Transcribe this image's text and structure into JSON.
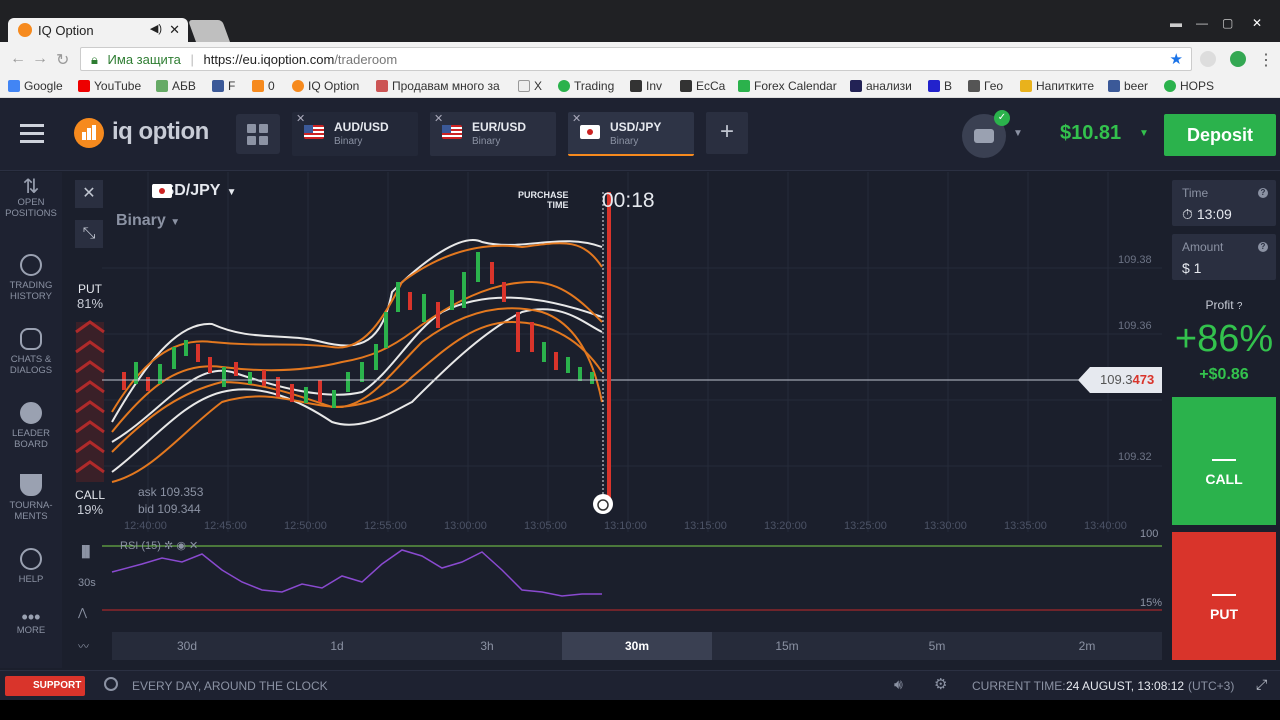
{
  "browser": {
    "tab_title": "IQ Option",
    "tab_close": "✕",
    "speaker": "◀)",
    "secure_label": "Има защита",
    "url_host": "https://eu.iqoption.com",
    "url_path": "/traderoom",
    "bookmarks": [
      "Google",
      "YouTube",
      "АБВ",
      "F",
      "0",
      "IQ Option",
      "Продавам много за",
      "X",
      "Trading",
      "Inv",
      "EcCa",
      "Forex Calendar",
      "анализи",
      "B",
      "Гео",
      "Напитките",
      "beer",
      "HOPS"
    ]
  },
  "header": {
    "logo": "iq option",
    "tabs": [
      {
        "pair": "AUD/USD",
        "kind": "Binary"
      },
      {
        "pair": "EUR/USD",
        "kind": "Binary"
      },
      {
        "pair": "USD/JPY",
        "kind": "Binary"
      }
    ],
    "add_tab": "+",
    "balance": "$10.81",
    "deposit": "Deposit"
  },
  "sidebar": [
    {
      "label": "OPEN POSITIONS"
    },
    {
      "label": "TRADING HISTORY"
    },
    {
      "label": "CHATS & DIALOGS"
    },
    {
      "label": "LEADER BOARD"
    },
    {
      "label": "TOURNA-MENTS"
    },
    {
      "label": "HELP"
    },
    {
      "label": "MORE"
    }
  ],
  "chart": {
    "pair": "USD/JPY",
    "type": "Binary",
    "purchase_label_1": "PURCHASE",
    "purchase_label_2": "TIME",
    "purchase_time": "00:18",
    "put_label": "PUT",
    "put_pct": "81%",
    "call_label": "CALL",
    "call_pct": "19%",
    "ask": "ask 109.353",
    "bid": "bid 109.344",
    "price_prefix": "109.3",
    "price_suffix": "473",
    "y_ticks": [
      "109.38",
      "109.36",
      "109.32"
    ],
    "x_ticks": [
      "12:40:00",
      "12:45:00",
      "12:50:00",
      "12:55:00",
      "13:00:00",
      "13:05:00",
      "13:10:00",
      "13:15:00",
      "13:20:00",
      "13:25:00",
      "13:30:00",
      "13:35:00",
      "13:40:00"
    ],
    "rsi_label": "RSI (15)",
    "rsi_low": "15%",
    "rsi_high": "100",
    "side_period": "30s",
    "close_icon": "✕",
    "timeframes": [
      "30d",
      "1d",
      "3h",
      "30m",
      "15m",
      "5m",
      "2m"
    ],
    "active_timeframe": "30m"
  },
  "panel": {
    "time_label": "Time",
    "time_value": "13:09",
    "amount_label": "Amount",
    "amount_value": "$ 1",
    "profit_label": "Profit",
    "profit_pct": "+86%",
    "profit_usd": "+$0.86",
    "call": "CALL",
    "put": "PUT"
  },
  "status": {
    "support": "SUPPORT",
    "hours": "EVERY DAY, AROUND THE CLOCK",
    "current_time_label": "CURRENT TIME:",
    "current_time": "24 AUGUST, 13:08:12",
    "tz": "(UTC+3)"
  },
  "colors": {
    "accent": "#f68a1e",
    "green": "#2bb24c",
    "red": "#d9342b"
  }
}
